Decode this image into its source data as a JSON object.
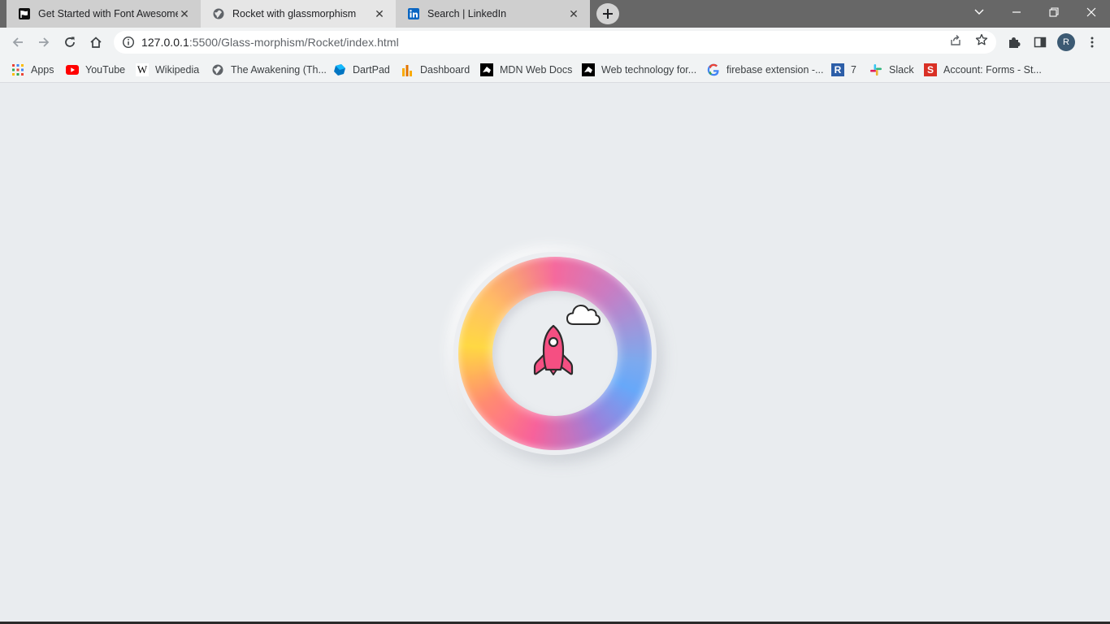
{
  "tabs": [
    {
      "title": "Get Started with Font Awesome",
      "favicon": "flag-icon",
      "active": false
    },
    {
      "title": "Rocket with glassmorphism",
      "favicon": "globe-icon",
      "active": true
    },
    {
      "title": "Search | LinkedIn",
      "favicon": "linkedin-icon",
      "active": false
    }
  ],
  "address": {
    "host": "127.0.0.1",
    "path": ":5500/Glass-morphism/Rocket/index.html"
  },
  "profile": {
    "initial": "R"
  },
  "bookmarks": [
    {
      "label": "Apps",
      "icon": "apps-grid-icon"
    },
    {
      "label": "YouTube",
      "icon": "youtube-icon"
    },
    {
      "label": "Wikipedia",
      "icon": "wikipedia-icon"
    },
    {
      "label": "The Awakening (Th...",
      "icon": "globe-icon"
    },
    {
      "label": "DartPad",
      "icon": "dartpad-icon"
    },
    {
      "label": "Dashboard",
      "icon": "dashboard-icon"
    },
    {
      "label": "MDN Web Docs",
      "icon": "mdn-icon"
    },
    {
      "label": "Web technology for...",
      "icon": "mdn-icon"
    },
    {
      "label": "firebase extension -...",
      "icon": "google-icon"
    },
    {
      "label": "7",
      "icon": "r-icon"
    },
    {
      "label": "Slack",
      "icon": "slack-icon"
    },
    {
      "label": "Account: Forms - St...",
      "icon": "s-icon"
    }
  ],
  "colors": {
    "page_bg": "#e9ecef",
    "rocket": "#f54f82",
    "ring_pink": "#f06b9c",
    "ring_blue": "#6aa8f5",
    "ring_yellow": "#ffd84a"
  }
}
